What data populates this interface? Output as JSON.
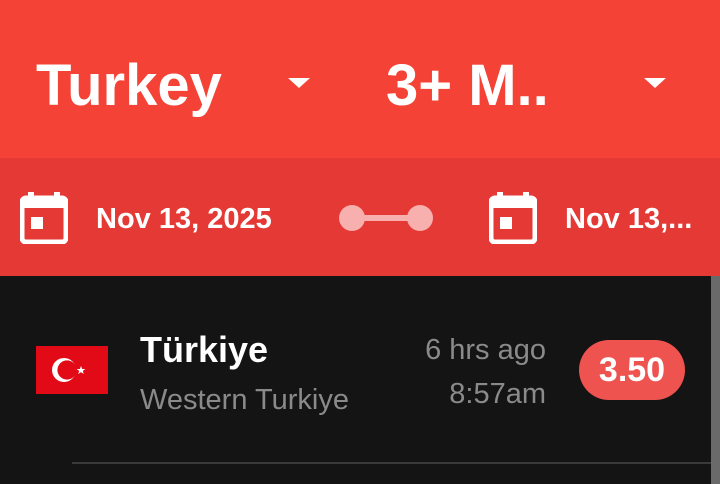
{
  "header": {
    "country_dropdown": {
      "value": "Turkey"
    },
    "magnitude_dropdown": {
      "value": "3+ M.."
    }
  },
  "date_range": {
    "start_date": "Nov 13, 2025",
    "end_date": "Nov 13,..."
  },
  "colors": {
    "header_red": "#f44336",
    "date_row_red": "#e53935",
    "badge_red": "#ef5350",
    "background": "#141414"
  },
  "earthquakes": [
    {
      "flag": "turkey-flag-icon",
      "country": "Türkiye",
      "region": "Western Turkiye",
      "ago": "6 hrs ago",
      "time": "8:57am",
      "magnitude": "3.50"
    }
  ]
}
